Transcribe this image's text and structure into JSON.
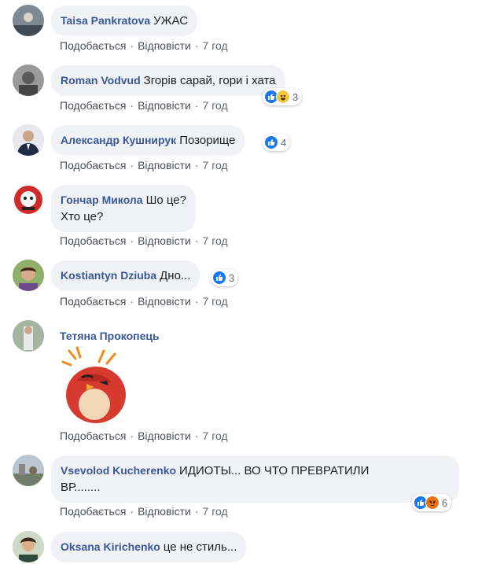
{
  "actions": {
    "like": "Подобається",
    "reply": "Відповісти",
    "dot": "·"
  },
  "comments": [
    {
      "author": "Taisa Pankratova",
      "text": "УЖАС",
      "time": "7 год"
    },
    {
      "author": "Roman Vodvud",
      "text": "Згорів сарай, гори і хата",
      "time": "7 год",
      "reactions": {
        "icons": [
          "like-icon",
          "haha-icon"
        ],
        "count": "3"
      }
    },
    {
      "author": "Александр Кушнирук",
      "text": "Позорище",
      "time": "7 год",
      "reactions": {
        "icons": [
          "like-icon"
        ],
        "count": "4"
      }
    },
    {
      "author": "Гончар Микола",
      "text_line1": "Шо це?",
      "text_line2": "Хто це?",
      "time": "7 год"
    },
    {
      "author": "Kostiantyn Dziuba",
      "text": "Дно...",
      "time": "7 год",
      "reactions": {
        "icons": [
          "like-icon"
        ],
        "count": "3"
      }
    },
    {
      "author": "Тетяна Прокопець",
      "sticker": "angry-red-bird-sticker",
      "time": "7 год"
    },
    {
      "author": "Vsevolod Kucherenko",
      "text_line1": "ИДИОТЫ... ВО ЧТО ПРЕВРАТИЛИ",
      "text_line2": "ВР........",
      "time": "7 год",
      "reactions": {
        "icons": [
          "like-icon",
          "angry-icon"
        ],
        "count": "6"
      }
    },
    {
      "author": "Oksana Kirichenko",
      "text": "це не стиль...",
      "time": ""
    }
  ],
  "colors": {
    "author": "#385898",
    "bubble": "#f0f2f5",
    "like": "#1877f2",
    "haha": "#f7c744",
    "angry": "#e9710f"
  }
}
